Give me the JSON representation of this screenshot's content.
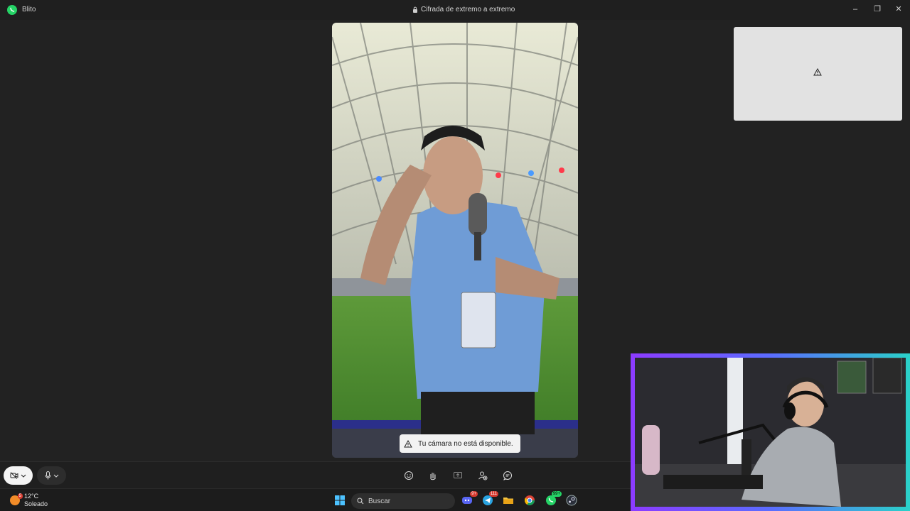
{
  "window": {
    "app_name": "Blito",
    "title": "Cifrada de extremo a extremo"
  },
  "call": {
    "toast_message": "Tu cámara no está disponible.",
    "self_view_icon": "warning-icon"
  },
  "controls": {
    "camera_icon": "camera-off-icon",
    "mic_icon": "microphone-icon",
    "center_icons": [
      "emoji-icon",
      "raise-hand-icon",
      "share-screen-icon",
      "add-participant-icon",
      "chat-icon"
    ]
  },
  "taskbar": {
    "weather_temp": "12°C",
    "weather_desc": "Soleado",
    "weather_badge": "5",
    "search_placeholder": "Buscar",
    "apps": [
      {
        "name": "discord-icon",
        "badge": "9+"
      },
      {
        "name": "telegram-icon",
        "badge": "111"
      },
      {
        "name": "file-explorer-icon",
        "badge": ""
      },
      {
        "name": "chrome-icon",
        "badge": ""
      },
      {
        "name": "whatsapp-icon",
        "badge": "99+"
      },
      {
        "name": "steam-icon",
        "badge": ""
      }
    ]
  },
  "colors": {
    "accent_green": "#25d366",
    "stream_frame_start": "#8c3bff",
    "stream_frame_end": "#2ad1c9"
  }
}
